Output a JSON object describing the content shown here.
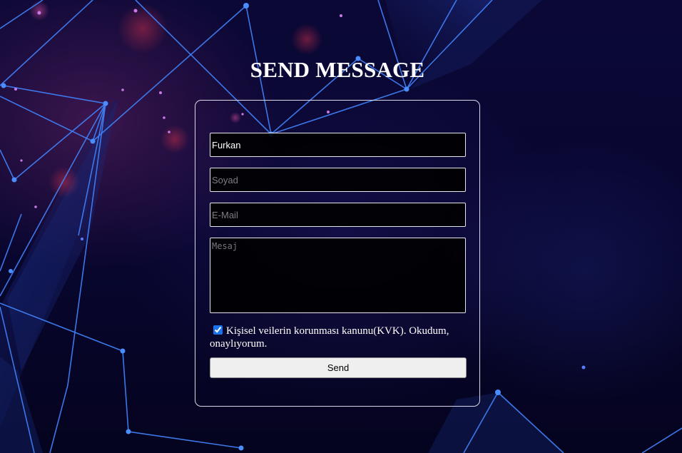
{
  "form": {
    "title": "SEND MESSAGE",
    "first_name": {
      "value": "Furkan",
      "placeholder": ""
    },
    "last_name": {
      "value": "",
      "placeholder": "Soyad"
    },
    "email": {
      "value": "",
      "placeholder": "E-Mail"
    },
    "message": {
      "value": "",
      "placeholder": "Mesaj"
    },
    "consent": {
      "checked": true,
      "label": "Kişisel veilerin korunması kanunu(KVK). Okudum, onaylıyorum."
    },
    "send_label": "Send"
  },
  "colors": {
    "background": "#07052a",
    "network_line": "#3d7bf0",
    "text": "#ffffff",
    "card_border": "#d8d8e8"
  }
}
